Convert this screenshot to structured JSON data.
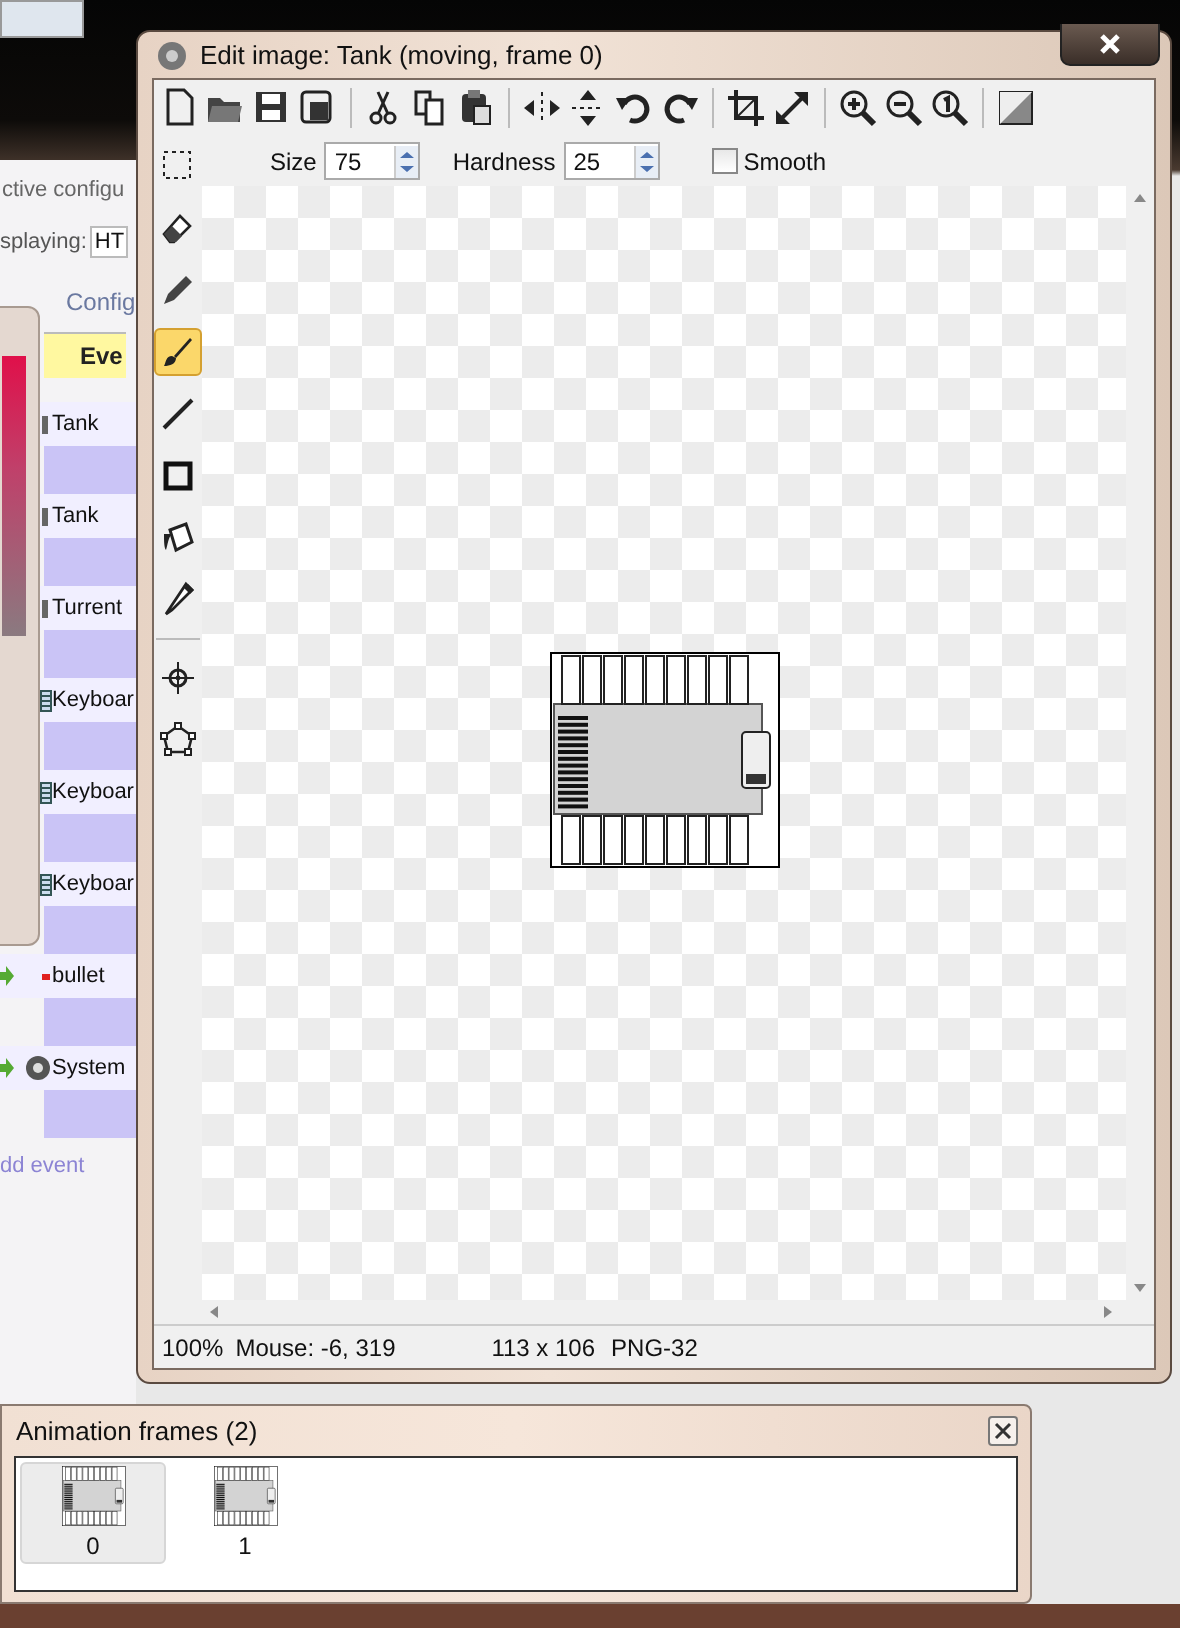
{
  "background_app": {
    "header_text": "ctive configu",
    "displaying_label": "splaying:",
    "displaying_value": "HT",
    "tabs": [
      {
        "label": "Config",
        "selected": false
      },
      {
        "label": "Eve",
        "selected": true
      }
    ],
    "events": [
      {
        "kind": "object",
        "label": "Tank"
      },
      {
        "kind": "object",
        "label": "Tank"
      },
      {
        "kind": "object",
        "label": "Turrent"
      },
      {
        "kind": "keyboard",
        "label": "Keyboar"
      },
      {
        "kind": "keyboard",
        "label": "Keyboar"
      },
      {
        "kind": "keyboard",
        "label": "Keyboar"
      },
      {
        "kind": "bullet",
        "label": "bullet"
      },
      {
        "kind": "system",
        "label": "System"
      }
    ],
    "add_event": "dd event"
  },
  "editor": {
    "title": "Edit image: Tank (moving, frame 0)",
    "toolbar": [
      {
        "kind": "new"
      },
      {
        "kind": "open"
      },
      {
        "kind": "save"
      },
      {
        "kind": "save-copy"
      },
      {
        "kind": "sep"
      },
      {
        "kind": "cut"
      },
      {
        "kind": "copy"
      },
      {
        "kind": "paste"
      },
      {
        "kind": "sep"
      },
      {
        "kind": "flip-h"
      },
      {
        "kind": "flip-v"
      },
      {
        "kind": "rotate-left"
      },
      {
        "kind": "rotate-right"
      },
      {
        "kind": "sep"
      },
      {
        "kind": "crop"
      },
      {
        "kind": "resize"
      },
      {
        "kind": "sep"
      },
      {
        "kind": "zoom-in"
      },
      {
        "kind": "zoom-out"
      },
      {
        "kind": "zoom-actual"
      },
      {
        "kind": "sep"
      },
      {
        "kind": "transparency"
      }
    ],
    "tools": [
      {
        "kind": "select",
        "selected": false
      },
      {
        "kind": "eraser",
        "selected": false
      },
      {
        "kind": "pencil",
        "selected": false
      },
      {
        "kind": "brush",
        "selected": true
      },
      {
        "kind": "line",
        "selected": false
      },
      {
        "kind": "rectangle",
        "selected": false
      },
      {
        "kind": "fill",
        "selected": false
      },
      {
        "kind": "eyedropper",
        "selected": false
      },
      {
        "kind": "sep"
      },
      {
        "kind": "hotspot",
        "selected": false
      },
      {
        "kind": "polygon",
        "selected": false
      }
    ],
    "size_label": "Size",
    "size": "75",
    "hardness_label": "Hardness",
    "hardness": "25",
    "smooth": {
      "label": "Smooth",
      "checked": false
    },
    "status": {
      "zoom": "100%",
      "mouse": "Mouse: -6, 319",
      "dimensions": "113 x 106",
      "format": "PNG-32"
    }
  },
  "animation_frames": {
    "title": "Animation frames (2)",
    "frames": [
      {
        "label": "0",
        "selected": true
      },
      {
        "label": "1",
        "selected": false
      }
    ]
  }
}
